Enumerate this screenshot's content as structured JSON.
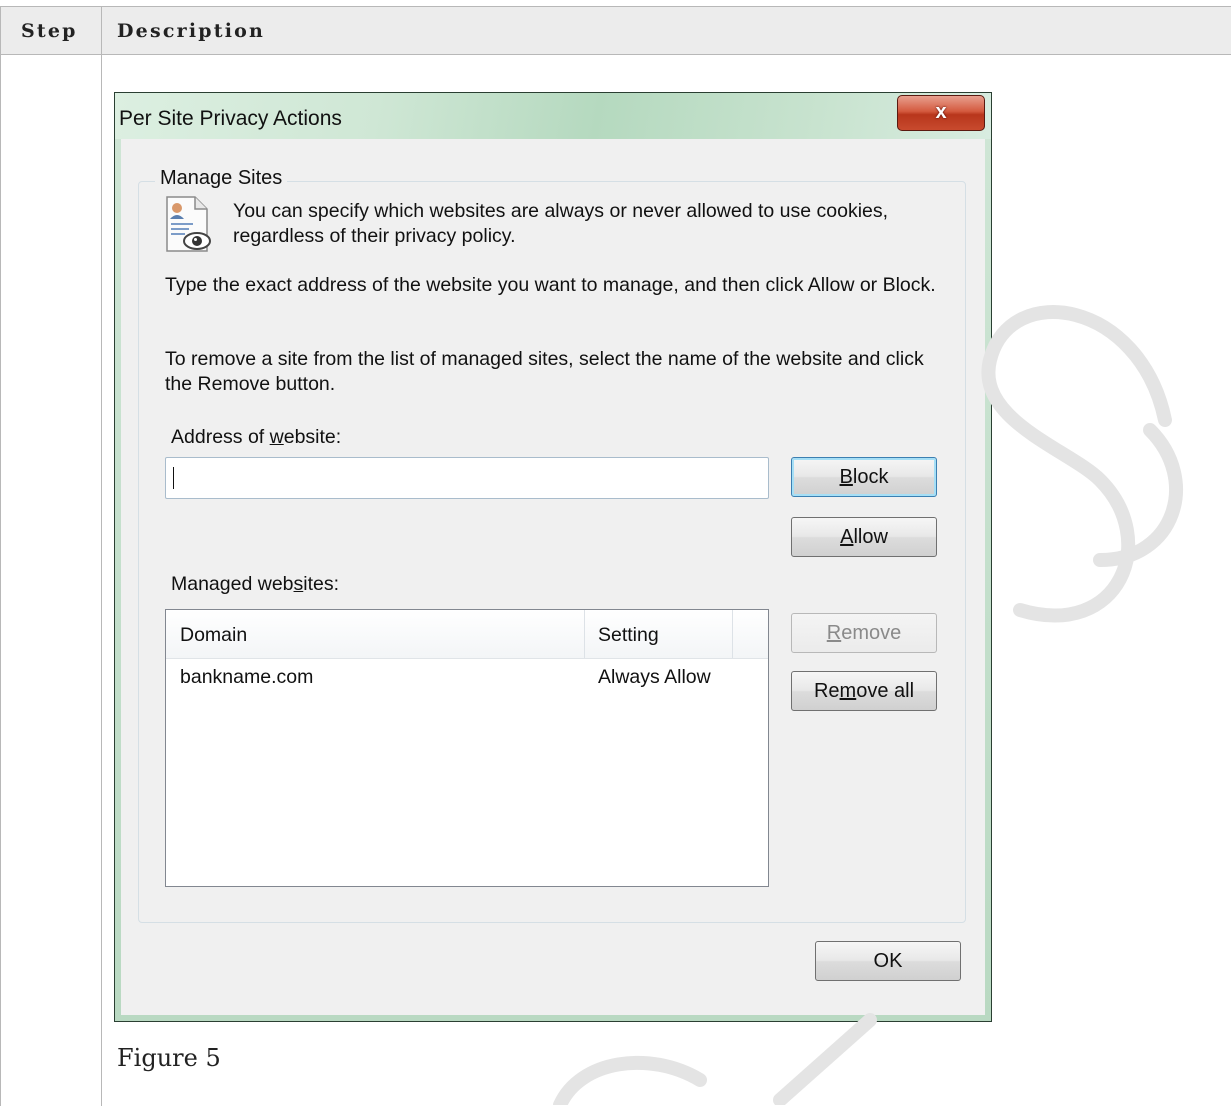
{
  "table": {
    "headers": [
      "Step",
      "Description"
    ],
    "caption": "Figure 5"
  },
  "dialog": {
    "title": "Per Site Privacy Actions",
    "close_label": "x",
    "group_label": "Manage Sites",
    "intro_text": "You can specify which websites are always or never allowed to use cookies, regardless of their privacy policy.",
    "instruction_1": "Type the exact address of the website you want to manage, and then click Allow or Block.",
    "instruction_2": "To remove a site from the list of managed sites, select the name of the website and click the Remove button.",
    "address_label": {
      "pre": "Address of ",
      "key": "w",
      "post": "ebsite:"
    },
    "address_value": "",
    "managed_label": {
      "pre": "Managed web",
      "key": "s",
      "post": "ites:"
    },
    "buttons": {
      "block": {
        "key": "B",
        "rest": "lock"
      },
      "allow": {
        "key": "A",
        "rest": "llow"
      },
      "remove": {
        "key": "R",
        "rest": "emove"
      },
      "remove_all": {
        "pre": "Re",
        "key": "m",
        "post": "ove all"
      },
      "ok": "OK"
    },
    "columns": [
      "Domain",
      "Setting"
    ],
    "rows": [
      {
        "domain": "bankname.com",
        "setting": "Always Allow"
      }
    ]
  }
}
